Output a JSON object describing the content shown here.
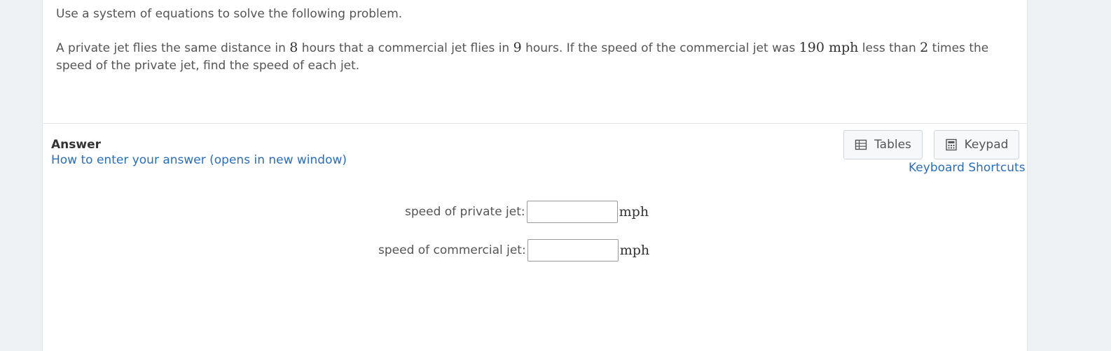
{
  "question": {
    "instruction": "Use a system of equations to solve the following problem.",
    "body": [
      {
        "t": "A private jet flies the same distance in "
      },
      {
        "m": "8"
      },
      {
        "t": " hours that a commercial jet flies in "
      },
      {
        "m": "9"
      },
      {
        "t": " hours.  If the speed of the commercial jet was "
      },
      {
        "m": "190 mph"
      },
      {
        "t": " less than "
      },
      {
        "m": "2"
      },
      {
        "t": " times the speed of the private jet, find the speed of each jet."
      }
    ]
  },
  "answer": {
    "title": "Answer",
    "howto_link": "How to enter your answer (opens in new window)"
  },
  "toolbar": {
    "tables_label": "Tables",
    "keypad_label": "Keypad",
    "shortcuts_label": "Keyboard Shortcuts"
  },
  "fields": [
    {
      "label": "speed of private jet:",
      "value": "",
      "unit": "mph"
    },
    {
      "label": "speed of commercial jet:",
      "value": "",
      "unit": "mph"
    }
  ],
  "colors": {
    "link": "#2a6ebb",
    "background": "#eef1f4"
  }
}
